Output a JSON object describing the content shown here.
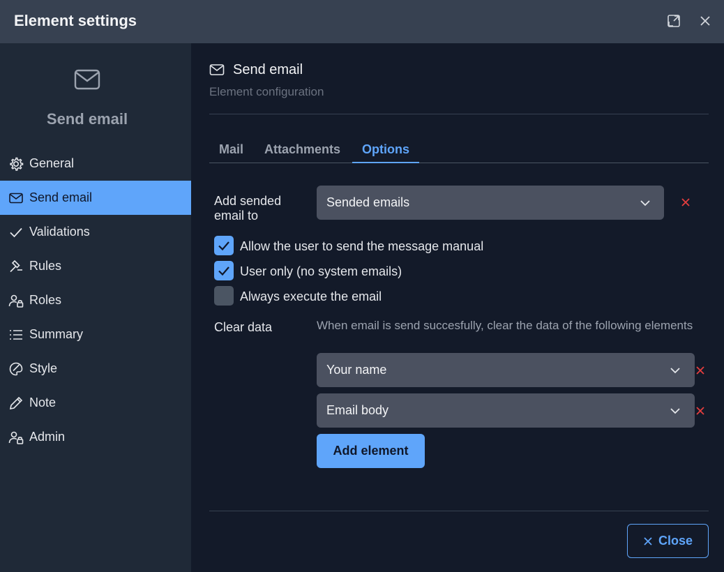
{
  "dialog": {
    "title": "Element settings"
  },
  "sidebar": {
    "header_label": "Send email",
    "items": [
      {
        "label": "General",
        "icon": "gear-icon"
      },
      {
        "label": "Send email",
        "icon": "envelope-icon",
        "active": true
      },
      {
        "label": "Validations",
        "icon": "check-icon"
      },
      {
        "label": "Rules",
        "icon": "gavel-icon"
      },
      {
        "label": "Roles",
        "icon": "user-lock-icon"
      },
      {
        "label": "Summary",
        "icon": "list-icon"
      },
      {
        "label": "Style",
        "icon": "palette-icon"
      },
      {
        "label": "Note",
        "icon": "pencil-icon"
      },
      {
        "label": "Admin",
        "icon": "user-lock-icon"
      }
    ]
  },
  "main": {
    "title": "Send email",
    "subtitle": "Element configuration",
    "tabs": [
      {
        "label": "Mail"
      },
      {
        "label": "Attachments"
      },
      {
        "label": "Options",
        "active": true
      }
    ],
    "options": {
      "add_sended_label": "Add sended email to",
      "add_sended_value": "Sended emails",
      "checkboxes": [
        {
          "label": "Allow the user to send the message manual",
          "checked": true
        },
        {
          "label": "User only (no system emails)",
          "checked": true
        },
        {
          "label": "Always execute the email",
          "checked": false
        }
      ],
      "clear_data_label": "Clear data",
      "clear_data_hint": "When email is send succesfully, clear the data of the following elements",
      "clear_elements": [
        {
          "value": "Your name"
        },
        {
          "value": "Email body"
        }
      ],
      "add_element_label": "Add element"
    },
    "close_label": "Close"
  },
  "colors": {
    "accent": "#5fa5fa",
    "danger": "#e53e3e",
    "titlebar": "#374151",
    "sidebar": "#1f2937",
    "main": "#131a29"
  }
}
